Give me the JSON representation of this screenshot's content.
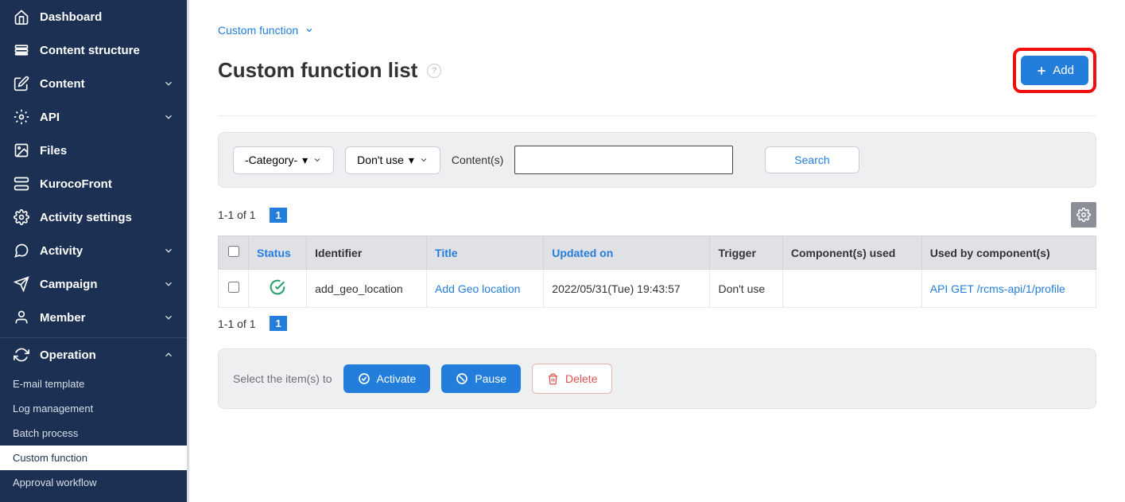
{
  "sidebar": {
    "items": [
      {
        "label": "Dashboard",
        "icon": "home",
        "expandable": false
      },
      {
        "label": "Content structure",
        "icon": "layers",
        "expandable": false
      },
      {
        "label": "Content",
        "icon": "edit",
        "expandable": true
      },
      {
        "label": "API",
        "icon": "api",
        "expandable": true
      },
      {
        "label": "Files",
        "icon": "image",
        "expandable": false
      },
      {
        "label": "KurocoFront",
        "icon": "server",
        "expandable": false
      },
      {
        "label": "Activity settings",
        "icon": "gear",
        "expandable": false
      },
      {
        "label": "Activity",
        "icon": "chat",
        "expandable": true
      },
      {
        "label": "Campaign",
        "icon": "send",
        "expandable": true
      },
      {
        "label": "Member",
        "icon": "user",
        "expandable": true
      }
    ],
    "operation": {
      "label": "Operation",
      "icon": "refresh",
      "children": [
        {
          "label": "E-mail template"
        },
        {
          "label": "Log management"
        },
        {
          "label": "Batch process"
        },
        {
          "label": "Custom function",
          "active": true
        },
        {
          "label": "Approval workflow"
        }
      ]
    }
  },
  "breadcrumb": {
    "label": "Custom function"
  },
  "page": {
    "title": "Custom function list"
  },
  "add_button": {
    "label": "Add"
  },
  "filters": {
    "category_label": "-Category-",
    "use_label": "Don't use",
    "contents_label": "Content(s)",
    "search_label": "Search",
    "search_value": ""
  },
  "pager": {
    "text": "1-1 of 1",
    "page": "1"
  },
  "table": {
    "headers": {
      "status": "Status",
      "identifier": "Identifier",
      "title": "Title",
      "updated": "Updated on",
      "trigger": "Trigger",
      "components_used": "Component(s) used",
      "used_by": "Used by component(s)"
    },
    "rows": [
      {
        "identifier": "add_geo_location",
        "title": "Add Geo location",
        "updated": "2022/05/31(Tue) 19:43:57",
        "trigger": "Don't use",
        "components_used": "",
        "used_by": "API GET /rcms-api/1/profile"
      }
    ]
  },
  "bulk": {
    "prompt": "Select the item(s) to",
    "activate": "Activate",
    "pause": "Pause",
    "delete": "Delete"
  }
}
